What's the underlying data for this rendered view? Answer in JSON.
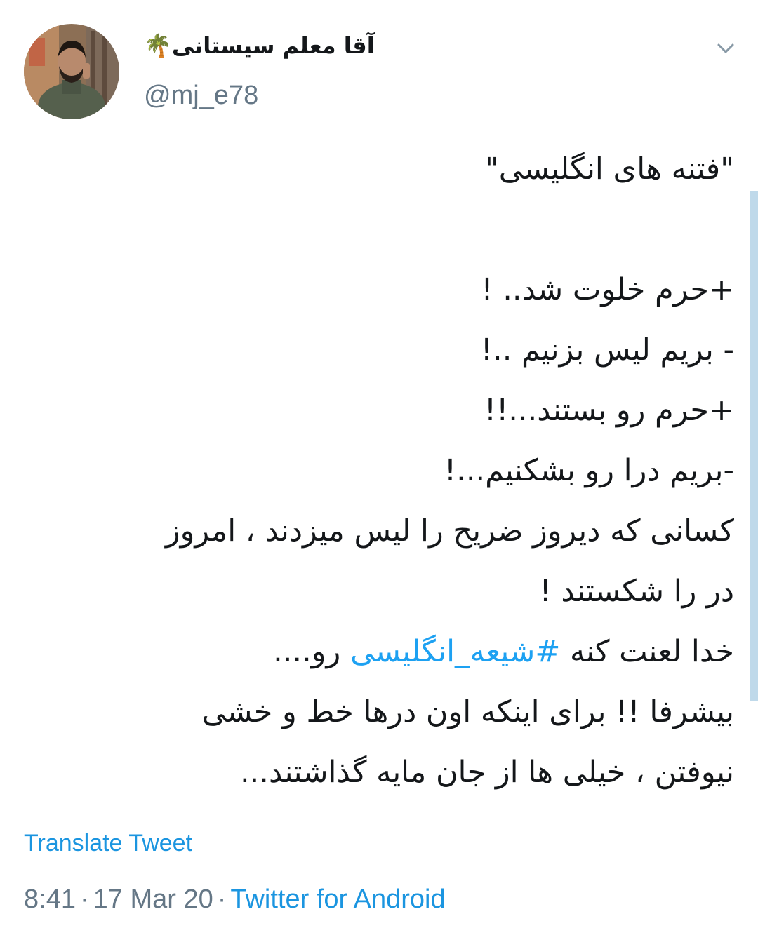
{
  "tweet": {
    "author": {
      "display_name": "آقا معلم سیستانی🌴",
      "handle": "@mj_e78"
    },
    "text_lines": [
      "\"فتنه های انگلیسی\"",
      "",
      "+حرم خلوت شد.. !",
      "- بریم لیس بزنیم ..!",
      "+حرم رو بستند...!!",
      "-بریم درا رو بشکنیم...!",
      "کسانی که دیروز ضریح را لیس میزدند ، امروز",
      "در را شکستند !"
    ],
    "hashtag_line": {
      "before": "خدا لعنت کنه ",
      "hashtag": "#شیعه_انگلیسی",
      "after": " رو...."
    },
    "text_lines_after": [
      "بیشرفا !! برای اینکه اون درها خط و خشی",
      "نیوفتن ، خیلی ها از جان مایه گذاشتند..."
    ],
    "translate_label": "Translate Tweet",
    "meta": {
      "time": "8:41",
      "separator": "·",
      "date": "17 Mar 20",
      "source": "Twitter for Android"
    }
  },
  "icons": {
    "caret": "chevron-down-icon",
    "avatar": "profile-photo"
  },
  "colors": {
    "text": "#14171a",
    "secondary": "#657786",
    "link": "#1b95e0",
    "hashtag": "#1da1f2"
  }
}
